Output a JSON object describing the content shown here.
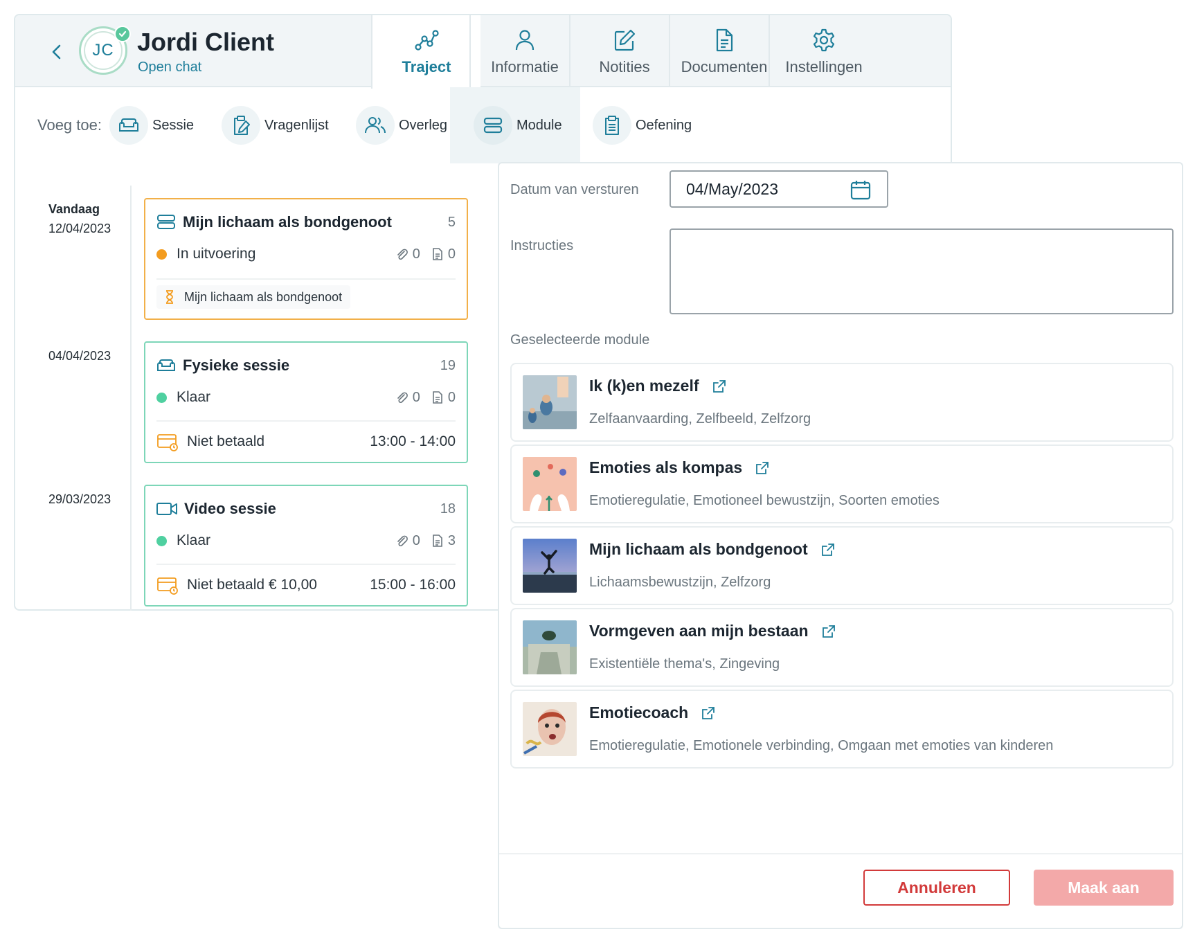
{
  "client": {
    "initials": "JC",
    "name": "Jordi Client",
    "open_chat": "Open chat"
  },
  "tabs": [
    {
      "label": "Traject",
      "icon": "route-icon",
      "active": true
    },
    {
      "label": "Informatie",
      "icon": "user-icon"
    },
    {
      "label": "Notities",
      "icon": "edit-note-icon"
    },
    {
      "label": "Documenten",
      "icon": "document-icon"
    },
    {
      "label": "Instellingen",
      "icon": "gear-icon"
    }
  ],
  "add": {
    "label": "Voeg toe:",
    "items": [
      {
        "label": "Sessie",
        "icon": "sofa-icon"
      },
      {
        "label": "Vragenlijst",
        "icon": "clipboard-edit-icon"
      },
      {
        "label": "Overleg",
        "icon": "users-icon"
      },
      {
        "label": "Module",
        "icon": "module-icon",
        "active": true
      },
      {
        "label": "Oefening",
        "icon": "clipboard-list-icon"
      }
    ]
  },
  "timeline": [
    {
      "date_top": "Vandaag",
      "date": "12/04/2023",
      "title": "Mijn lichaam als bondgenoot",
      "number": "5",
      "status": "In uitvoering",
      "status_color": "#f39c1f",
      "attachments": "0",
      "documents": "0",
      "footer": "Mijn lichaam als bondgenoot"
    },
    {
      "date": "04/04/2023",
      "title": "Fysieke sessie",
      "number": "19",
      "status": "Klaar",
      "status_color": "#4fd0a0",
      "attachments": "0",
      "documents": "0",
      "footer": "Niet betaald",
      "time": "13:00 - 14:00"
    },
    {
      "date": "29/03/2023",
      "title": "Video sessie",
      "number": "18",
      "status": "Klaar",
      "status_color": "#4fd0a0",
      "attachments": "0",
      "documents": "3",
      "footer": "Niet betaald € 10,00",
      "time": "15:00 - 16:00"
    }
  ],
  "form": {
    "date_label": "Datum van versturen",
    "date_value": "04/May/2023",
    "instructions_label": "Instructies",
    "instructions_value": "",
    "selected_label": "Geselecteerde module"
  },
  "modules": [
    {
      "title": "Ik (k)en mezelf",
      "tags": "Zelfaanvaarding, Zelfbeeld, Zelfzorg"
    },
    {
      "title": "Emoties als kompas",
      "tags": "Emotieregulatie, Emotioneel bewustzijn, Soorten emoties"
    },
    {
      "title": "Mijn lichaam als bondgenoot",
      "tags": "Lichaamsbewustzijn, Zelfzorg"
    },
    {
      "title": "Vormgeven aan mijn bestaan",
      "tags": "Existentiële thema's, Zingeving"
    },
    {
      "title": "Emotiecoach",
      "tags": "Emotieregulatie, Emotionele verbinding, Omgaan met emoties van kinderen"
    }
  ],
  "actions": {
    "cancel": "Annuleren",
    "create": "Maak aan"
  },
  "colors": {
    "accent": "#1e7e9a",
    "danger": "#d23a3a",
    "danger_disabled": "#f3a9a9",
    "in_progress": "#f39c1f",
    "done": "#4fd0a0"
  }
}
